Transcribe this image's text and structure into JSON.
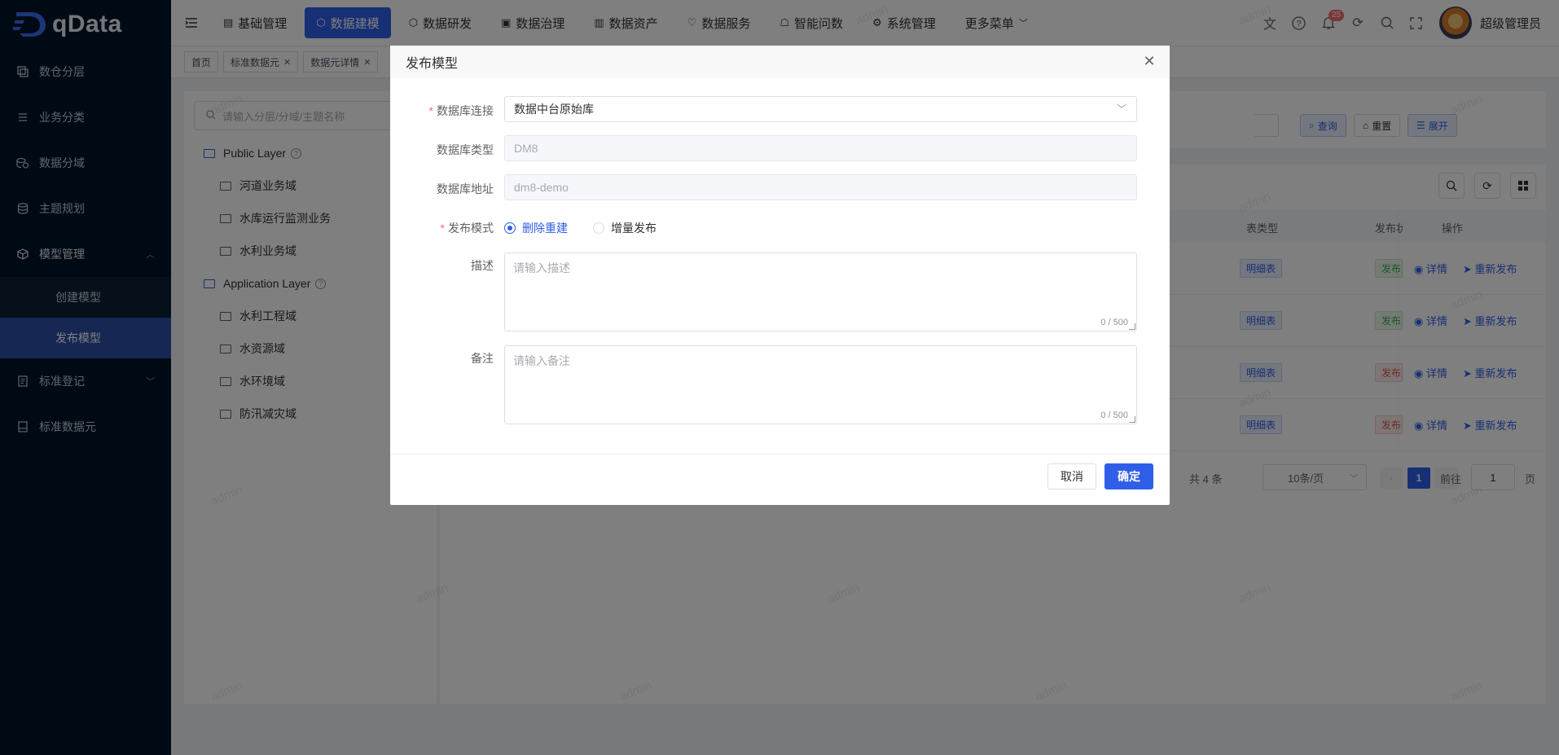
{
  "brand": {
    "name": "qData"
  },
  "sidebar": {
    "items": [
      {
        "label": "数仓分层",
        "icon": "layers-icon"
      },
      {
        "label": "业务分类",
        "icon": "list-icon"
      },
      {
        "label": "数据分域",
        "icon": "domain-icon"
      },
      {
        "label": "主题规划",
        "icon": "database-icon"
      },
      {
        "label": "模型管理",
        "icon": "cube-icon"
      },
      {
        "label": "标准登记",
        "icon": "doc-icon"
      },
      {
        "label": "标准数据元",
        "icon": "file-icon"
      }
    ],
    "submenu": [
      {
        "label": "创建模型"
      },
      {
        "label": "发布模型"
      }
    ]
  },
  "header": {
    "nav": [
      {
        "label": "基础管理"
      },
      {
        "label": "数据建模"
      },
      {
        "label": "数据研发"
      },
      {
        "label": "数据治理"
      },
      {
        "label": "数据资产"
      },
      {
        "label": "数据服务"
      },
      {
        "label": "智能问数"
      },
      {
        "label": "系统管理"
      },
      {
        "label": "更多菜单"
      }
    ],
    "notification_count": "25",
    "username": "超级管理员"
  },
  "tags": [
    {
      "label": "首页"
    },
    {
      "label": "标准数据元"
    },
    {
      "label": "数据元详情"
    }
  ],
  "tree": {
    "search_placeholder": "请输入分层/分域/主题名称",
    "groups": [
      {
        "label": "Public Layer",
        "children": [
          "河道业务域",
          "水库运行监测业务",
          "水利业务域"
        ]
      },
      {
        "label": "Application Layer",
        "children": [
          "水利工程域",
          "水资源域",
          "水环境域",
          "防汛减灾域"
        ]
      }
    ]
  },
  "query": {
    "search_btn": "查询",
    "reset_btn": "重置",
    "expand_btn": "展开"
  },
  "table": {
    "headers": {
      "table_type": "表类型",
      "publish_status": "发布状态",
      "operation": "操作"
    },
    "rows": [
      {
        "type": "明细表",
        "status": "发布成功",
        "status_kind": "ok"
      },
      {
        "type": "明细表",
        "status": "发布成功",
        "status_kind": "ok"
      },
      {
        "type": "明细表",
        "status": "发布失败",
        "status_kind": "fail"
      },
      {
        "type": "明细表",
        "status": "发布失败",
        "status_kind": "fail"
      }
    ],
    "op_detail": "详情",
    "op_republish": "重新发布"
  },
  "pagination": {
    "total_text": "共 4 条",
    "page_size": "10条/页",
    "current_page": "1",
    "goto_label": "前往",
    "goto_value": "1",
    "page_suffix": "页"
  },
  "watermark": "admin",
  "modal": {
    "title": "发布模型",
    "db_conn_label": "数据库连接",
    "db_conn_value": "数据中台原始库",
    "db_type_label": "数据库类型",
    "db_type_value": "DM8",
    "db_addr_label": "数据库地址",
    "db_addr_value": "dm8-demo",
    "mode_label": "发布模式",
    "mode_options": [
      "删除重建",
      "增量发布"
    ],
    "mode_selected": "删除重建",
    "desc_label": "描述",
    "desc_placeholder": "请输入描述",
    "desc_count": "0 / 500",
    "remark_label": "备注",
    "remark_placeholder": "请输入备注",
    "remark_count": "0 / 500",
    "cancel": "取消",
    "confirm": "确定"
  }
}
